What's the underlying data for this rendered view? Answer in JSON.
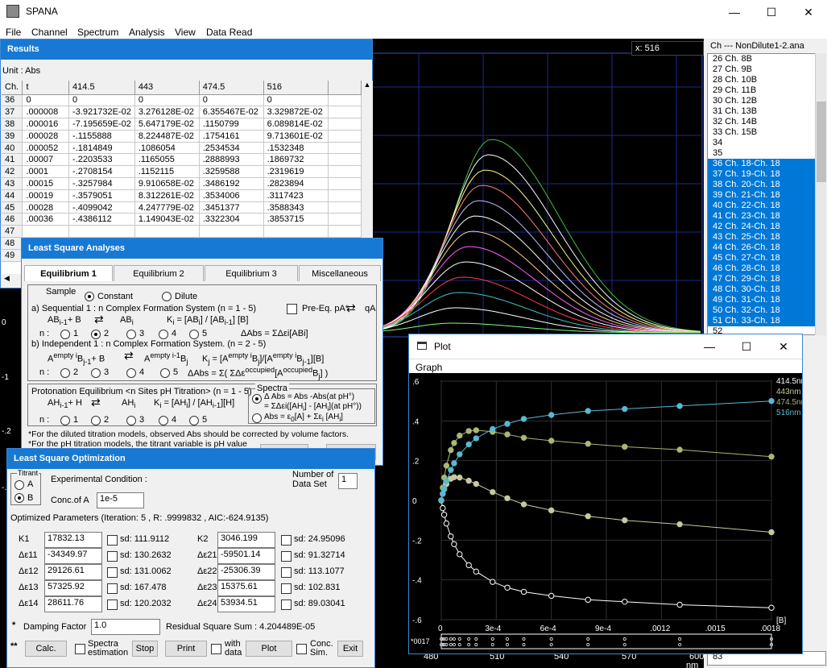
{
  "app": {
    "title": "SPANA"
  },
  "menu": [
    "File",
    "Channel",
    "Spectrum",
    "Analysis",
    "View",
    "Data Read"
  ],
  "readout": "x: 516",
  "bg_axis": {
    "y_ticks": [
      "0",
      "-1",
      "-.2",
      "-.3"
    ],
    "x_ticks": [
      "480",
      "510",
      "540",
      "570",
      "600"
    ],
    "x_unit": "nm"
  },
  "list": {
    "title": "Ch --- NonDilute1-2.ana",
    "items": [
      "26 Ch. 8B",
      "27 Ch. 9B",
      "28 Ch. 10B",
      "29 Ch. 11B",
      "30 Ch. 12B",
      "31 Ch. 13B",
      "32 Ch. 14B",
      "33 Ch. 15B",
      "34",
      "35",
      "36 Ch. 18-Ch. 18",
      "37 Ch. 19-Ch. 18",
      "38 Ch. 20-Ch. 18",
      "39 Ch. 21-Ch. 18",
      "40 Ch. 22-Ch. 18",
      "41 Ch. 23-Ch. 18",
      "42 Ch. 24-Ch. 18",
      "43 Ch. 25-Ch. 18",
      "44 Ch. 26-Ch. 18",
      "45 Ch. 27-Ch. 18",
      "46 Ch. 28-Ch. 18",
      "47 Ch. 29-Ch. 18",
      "48 Ch. 30-Ch. 18",
      "49 Ch. 31-Ch. 18",
      "50 Ch. 32-Ch. 18",
      "51 Ch. 33-Ch. 18",
      "52"
    ],
    "last": "83"
  },
  "results": {
    "title": "Results",
    "unit": "Unit : Abs",
    "headers": [
      "Ch.",
      "t",
      "414.5",
      "443",
      "474.5",
      "516"
    ],
    "rows": [
      [
        "36",
        "0",
        "0",
        "0",
        "0",
        "0"
      ],
      [
        "37",
        ".000008",
        "-3.921732E-02",
        "3.276128E-02",
        "6.355467E-02",
        "3.329872E-02"
      ],
      [
        "38",
        ".000016",
        "-7.195659E-02",
        "5.647179E-02",
        ".1150799",
        "6.089814E-02"
      ],
      [
        "39",
        ".000028",
        "-.1155888",
        "8.224487E-02",
        ".1754161",
        "9.713601E-02"
      ],
      [
        "40",
        ".000052",
        "-.1814849",
        ".1086054",
        ".2534534",
        ".1532348"
      ],
      [
        "41",
        ".00007",
        "-.2203533",
        ".1165055",
        ".2888993",
        ".1869732"
      ],
      [
        "42",
        ".0001",
        "-.2708154",
        ".1152115",
        ".3259588",
        ".2319619"
      ],
      [
        "43",
        ".00015",
        "-.3257984",
        "9.910658E-02",
        ".3486192",
        ".2823894"
      ],
      [
        "44",
        ".00019",
        "-.3579051",
        "8.312261E-02",
        ".3534006",
        ".3117423"
      ],
      [
        "45",
        ".00028",
        "-.4099042",
        "4.247779E-02",
        ".3451377",
        ".3588343"
      ],
      [
        "46",
        ".00036",
        "-.4386112",
        "1.149043E-02",
        ".3322304",
        ".3853715"
      ]
    ],
    "hidden_rows": [
      "47",
      "48",
      "49"
    ]
  },
  "lsa": {
    "title": "Least Square Analyses",
    "tabs": [
      "Equilibrium 1",
      "Equilibrium 2",
      "Equilibrium 3",
      "Miscellaneous"
    ],
    "sample_label": "Sample",
    "constant": "Constant",
    "dilute": "Dilute",
    "seq_text": "a)  Sequential 1 : n  Complex Formation System   (n = 1 - 5)",
    "preeq": "Pre-Eq.  pA*",
    "preeq_r": "qA",
    "seq_eq_l": "AB",
    "seq_eq_l2": "i-1",
    "seq_eq_l3": "+ B",
    "seq_eq_r": "AB",
    "seq_eq_r2": "i",
    "seq_k": "K",
    "seq_k2": "i",
    "seq_k3": " = [AB",
    "seq_k4": "i",
    "seq_k5": "] / [AB",
    "seq_k6": "i-1",
    "seq_k7": "] [B]",
    "n_label": "n :",
    "seq_n": [
      "1",
      "2",
      "3",
      "4",
      "5"
    ],
    "seq_dabs": "ΔAbs = ΣΔεi[ABi]",
    "ind_text": "b)  Independent 1 : n  Complex Formation System.   (n = 2 - 5)",
    "ind_a": "A",
    "ind_a2": "empty i",
    "ind_b": "B",
    "ind_b2": "j-1",
    "ind_pb": "+ B",
    "ind_c": "A",
    "ind_c2": "empty i-1",
    "ind_d": "B",
    "ind_d2": "j",
    "ind_k": "K",
    "ind_k2": "j",
    "ind_k3": " = [A",
    "ind_k4": "empty i",
    "ind_k5": "B",
    "ind_k6": "j",
    "ind_k7": "]/[A",
    "ind_k8": "empty i",
    "ind_k9": "B",
    "ind_k10": "j-1",
    "ind_k11": "][B]",
    "ind_n": [
      "2",
      "3",
      "4",
      "5"
    ],
    "ind_dabs": "ΔAbs = Σ( ΣΔε",
    "ind_dabs2": "occupied",
    "ind_dabs3": "[A",
    "ind_dabs4": "occupied",
    "ind_dabs5": "B",
    "ind_dabs6": "j",
    "ind_dabs7": "] )",
    "prot_text": "Protonation Equilibrium <n Sites pH Titration>  (n = 1 - 5)",
    "prot_eq_l": "AH",
    "prot_eq_l2": "i-1",
    "prot_eq_l3": "+ H",
    "prot_eq_r": "AH",
    "prot_eq_r2": "i",
    "prot_k": "K",
    "prot_k2": "i",
    "prot_k3": " = [AH",
    "prot_k4": "i",
    "prot_k5": "] / [AH",
    "prot_k6": "i-1",
    "prot_k7": "][H]",
    "prot_n": [
      "1",
      "2",
      "3",
      "4",
      "5"
    ],
    "spectra_label": "Spectra",
    "spec1": "Δ Abs = Abs -Abs(at pH°)",
    "spec1b": "= ΣΔεi([AH",
    "spec1c": "i",
    "spec1d": "] - [AH",
    "spec1e": "i",
    "spec1f": "](at pH°))",
    "spec2": "Abs = ε",
    "spec2b": "0",
    "spec2c": "[A] + Σε",
    "spec2d": "i",
    "spec2e": " [AH",
    "spec2f": "i",
    "spec2g": "]",
    "note1": "*For the diluted titration models, observed Abs should be corrected by volume factors.",
    "note2": "*For the pH titration models, the titrant variable is pH value",
    "btn_ok": "G...",
    "btn_cancel": "Cancel"
  },
  "lso": {
    "title": "Least Square Optimization",
    "titrant_label": "Titrant",
    "titrant_a": "A",
    "titrant_b": "B",
    "exp_cond": "Experimental Condition :",
    "conc_label": "Conc.of A",
    "conc_value": "1e-5",
    "num_data_label1": "Number of",
    "num_data_label2": "Data Set",
    "num_data_value": "1",
    "opt_params": "Optimized Parameters (Iteration: 5 , R: .9999832 , AIC:-624.9135)",
    "params": [
      {
        "label": "K1",
        "value": "17832.13",
        "sd": "sd: 111.9112"
      },
      {
        "label": "Δε11",
        "value": "-34349.97",
        "sd": "sd: 130.2632"
      },
      {
        "label": "Δε12",
        "value": "29126.61",
        "sd": "sd: 131.0062"
      },
      {
        "label": "Δε13",
        "value": "57325.92",
        "sd": "sd: 167.478"
      },
      {
        "label": "Δε14",
        "value": "28611.76",
        "sd": "sd: 120.2032"
      }
    ],
    "params2": [
      {
        "label": "K2",
        "value": "3046.199",
        "sd": "sd: 24.95096"
      },
      {
        "label": "Δε21",
        "value": "-59501.14",
        "sd": "sd: 91.32714"
      },
      {
        "label": "Δε22",
        "value": "-25306.39",
        "sd": "sd: 113.1077"
      },
      {
        "label": "Δε23",
        "value": "15375.61",
        "sd": "sd: 102.831"
      },
      {
        "label": "Δε24",
        "value": "53934.51",
        "sd": "sd: 89.03041"
      }
    ],
    "damping_star": "*",
    "damping_label": "Damping Factor",
    "damping_value": "1.0",
    "residual": "Residual Square Sum :  4.204489E-05",
    "stars": "**",
    "btn_calc": "Calc.",
    "spectra_est": "Spectra estimation",
    "btn_stop": "Stop",
    "btn_print": "Print",
    "with_data": "with data",
    "btn_plot": "Plot",
    "conc_sim": "Conc. Sim.",
    "btn_exit": "Exit"
  },
  "plot": {
    "title": "Plot",
    "menu": "Graph",
    "y_ticks": [
      ".6",
      ".4",
      ".2",
      "0",
      "-.2",
      "-.4",
      "-.6"
    ],
    "x_ticks": [
      "0",
      "3e-4",
      "6e-4",
      "9e-4",
      ".0012",
      ".0015",
      ".0018"
    ],
    "x_unit": "[B]",
    "bottom_label": "*0017",
    "legend": [
      {
        "name": "414.5nm",
        "color": "#ffffff"
      },
      {
        "name": "443nm",
        "color": "#c8c8a0"
      },
      {
        "name": "474.5nm",
        "color": "#a8b870"
      },
      {
        "name": "516nm",
        "color": "#5ab8d0"
      }
    ]
  },
  "chart_data": {
    "type": "scatter",
    "xlabel": "[B]",
    "ylabel": "",
    "xlim": [
      0,
      0.0018
    ],
    "ylim": [
      -0.6,
      0.6
    ],
    "x": [
      0,
      8e-06,
      1.6e-05,
      2.8e-05,
      5.2e-05,
      7e-05,
      0.0001,
      0.00015,
      0.00019,
      0.00028,
      0.00036,
      0.00045,
      0.0006,
      0.0008,
      0.001,
      0.0013,
      0.0018
    ],
    "series": [
      {
        "name": "414.5nm",
        "color": "#ffffff",
        "values": [
          0,
          -0.039,
          -0.072,
          -0.116,
          -0.181,
          -0.22,
          -0.271,
          -0.326,
          -0.358,
          -0.41,
          -0.439,
          -0.46,
          -0.48,
          -0.5,
          -0.51,
          -0.525,
          -0.54
        ]
      },
      {
        "name": "443nm",
        "color": "#c8c8a0",
        "values": [
          0,
          0.033,
          0.056,
          0.082,
          0.109,
          0.117,
          0.115,
          0.099,
          0.083,
          0.042,
          0.011,
          -0.02,
          -0.05,
          -0.08,
          -0.1,
          -0.12,
          -0.16
        ]
      },
      {
        "name": "474.5nm",
        "color": "#a8b870",
        "values": [
          0,
          0.064,
          0.115,
          0.175,
          0.253,
          0.289,
          0.326,
          0.349,
          0.353,
          0.345,
          0.332,
          0.315,
          0.3,
          0.285,
          0.27,
          0.255,
          0.22
        ]
      },
      {
        "name": "516nm",
        "color": "#5ab8d0",
        "values": [
          0,
          0.033,
          0.061,
          0.097,
          0.153,
          0.187,
          0.232,
          0.282,
          0.312,
          0.359,
          0.385,
          0.41,
          0.43,
          0.45,
          0.46,
          0.475,
          0.5
        ]
      }
    ]
  }
}
